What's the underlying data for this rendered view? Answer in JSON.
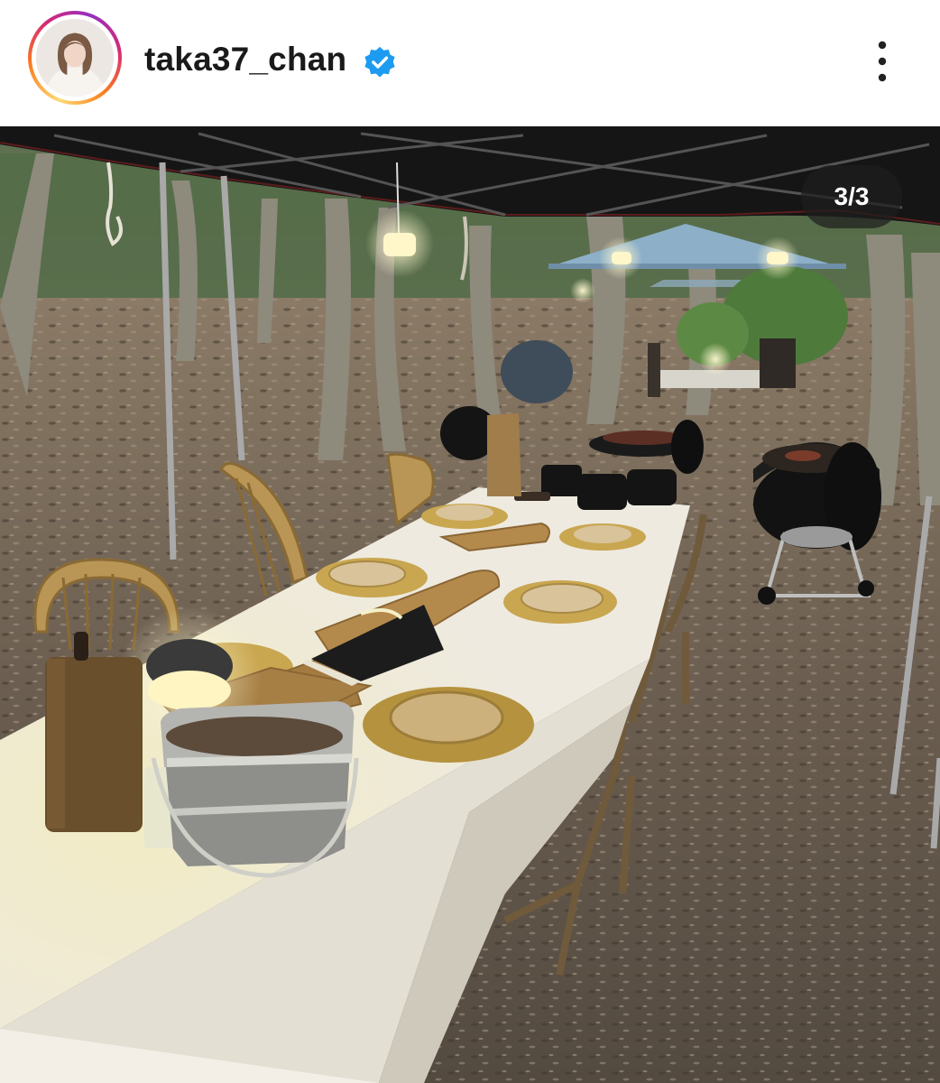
{
  "post": {
    "username": "taka37_chan",
    "verified": true,
    "avatar_icon": "profile-avatar",
    "menu_icon": "more-options-icon",
    "carousel": {
      "indicator": "3/3"
    }
  },
  "colors": {
    "story_ring": [
      "#feda75",
      "#fa7e1e",
      "#d62976",
      "#962fbf"
    ],
    "verified_badge": "#1d9bf0",
    "counter_bg": "#1e1e1e"
  }
}
